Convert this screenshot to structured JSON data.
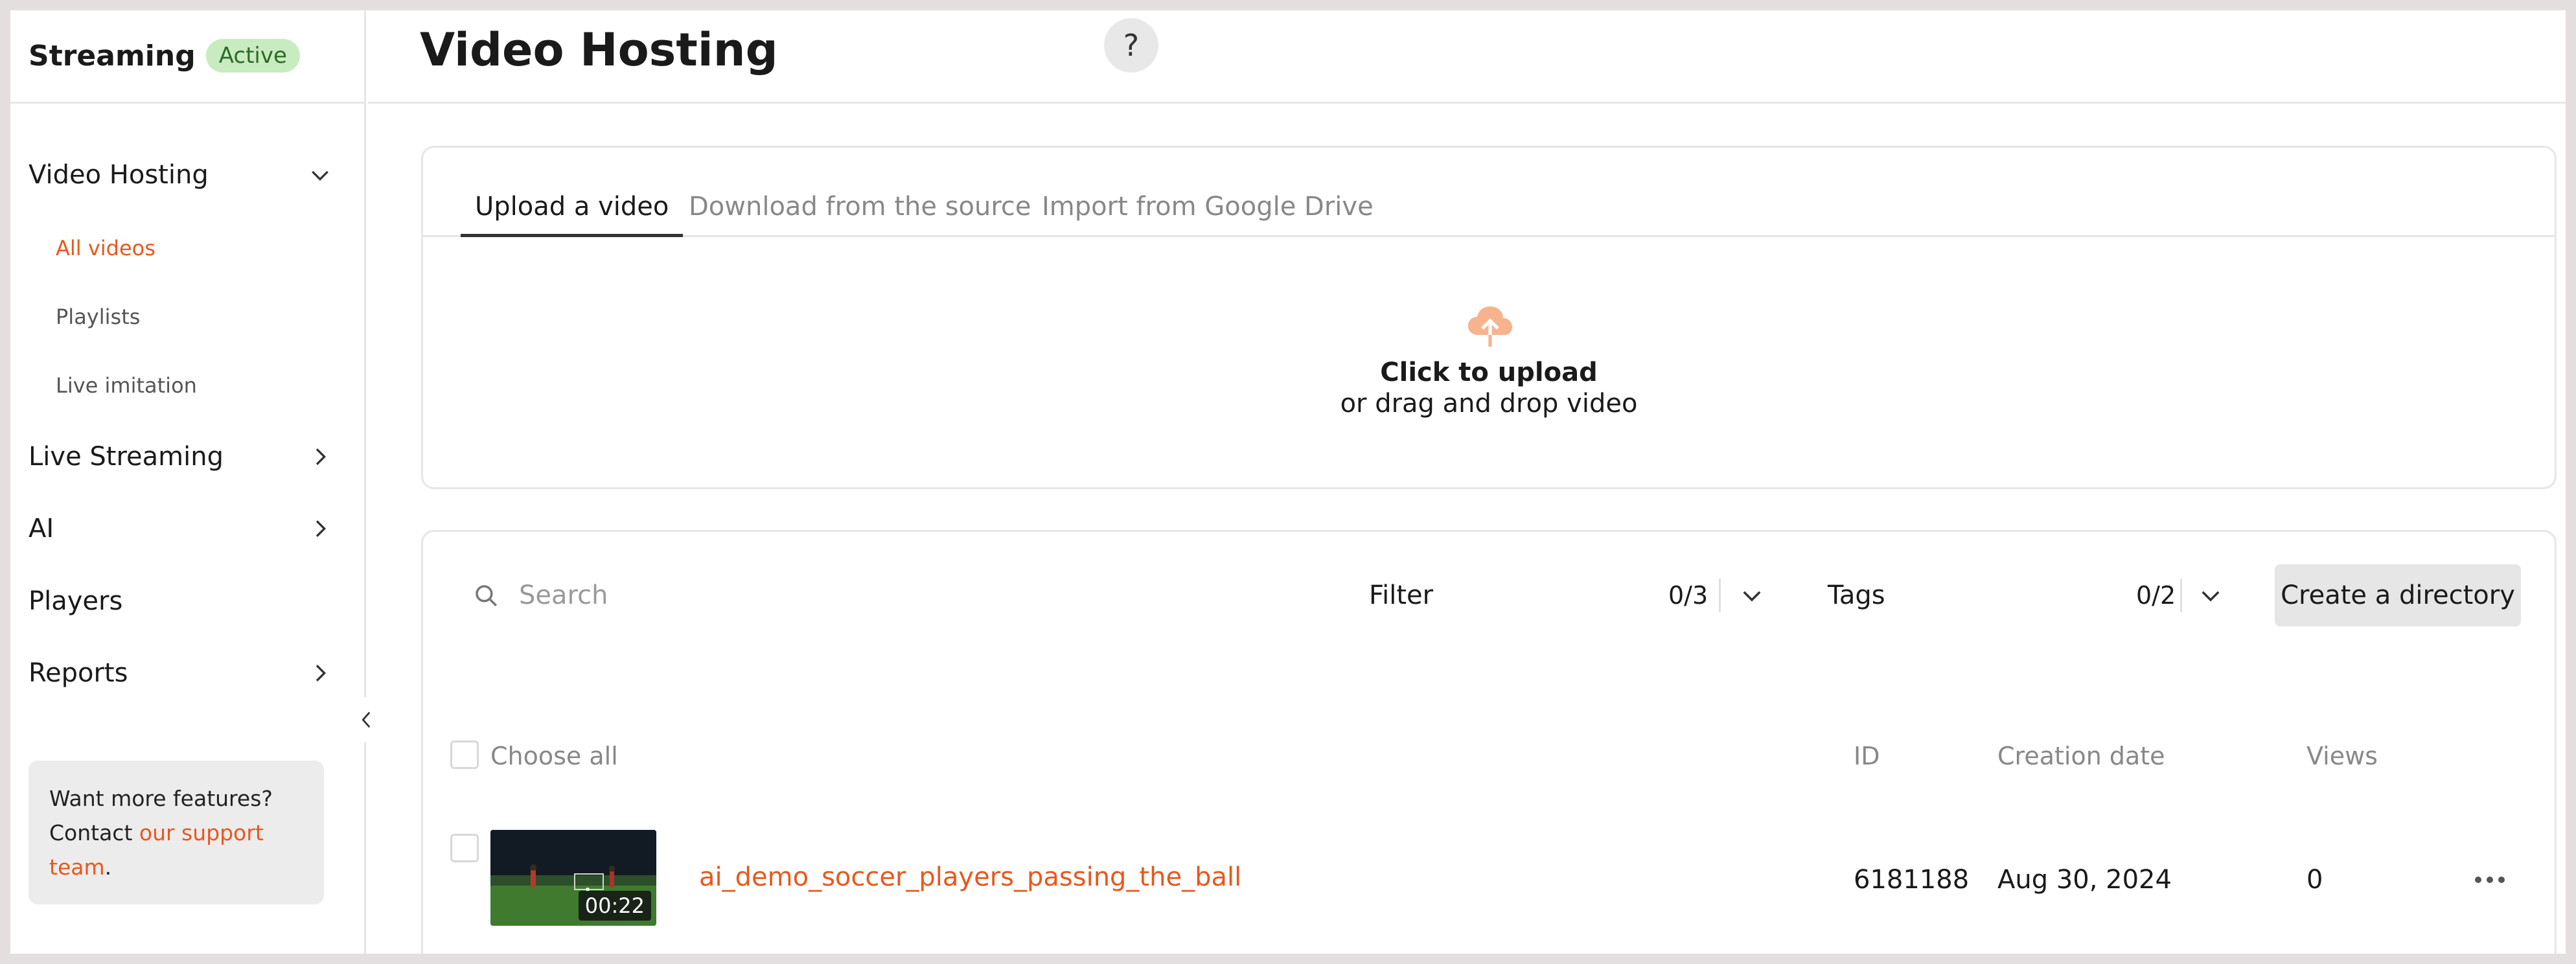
{
  "sidebar": {
    "brand": "Streaming",
    "badge": "Active",
    "items": [
      {
        "label": "Video Hosting",
        "expanded": true
      },
      {
        "label": "Live Streaming"
      },
      {
        "label": "AI"
      },
      {
        "label": "Players"
      },
      {
        "label": "Reports"
      }
    ],
    "subitems": [
      {
        "label": "All videos",
        "active": true
      },
      {
        "label": "Playlists"
      },
      {
        "label": "Live imitation"
      }
    ],
    "promo": {
      "line1": "Want more features?",
      "line2_prefix": "Contact ",
      "link1": "our support",
      "link2": "team",
      "suffix": "."
    }
  },
  "header": {
    "title": "Video Hosting",
    "help": "?"
  },
  "upload": {
    "tabs": [
      "Upload a video",
      "Download from the source",
      "Import from Google Drive"
    ],
    "title": "Click to upload",
    "subtitle": "or drag and drop video"
  },
  "toolbar": {
    "search_placeholder": "Search",
    "filter_label": "Filter",
    "filter_count": "0/3",
    "tags_label": "Tags",
    "tags_count": "0/2",
    "create_label": "Create a directory"
  },
  "table": {
    "choose_all": "Choose all",
    "columns": [
      "ID",
      "Creation date",
      "Views"
    ],
    "rows": [
      {
        "title": "ai_demo_soccer_players_passing_the_ball",
        "duration": "00:22",
        "id": "6181188",
        "date": "Aug 30, 2024",
        "views": "0"
      }
    ]
  },
  "colors": {
    "accent": "#e8581c",
    "badge_bg": "#c8ebc0",
    "upload_icon": "#f7b38d"
  }
}
